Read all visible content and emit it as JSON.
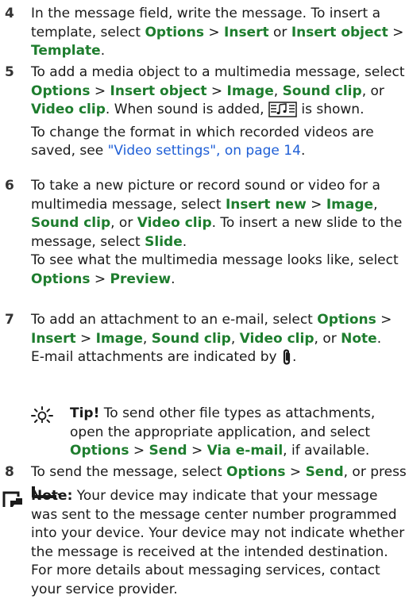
{
  "steps": [
    {
      "number": "4",
      "t1": "In the message field, write the message. To insert a template, select ",
      "options": "Options",
      "sep1": " > ",
      "insert": "Insert",
      "or1": " or ",
      "insert_object": "Insert object",
      "sep2": " > ",
      "template": "Template",
      "end": "."
    },
    {
      "number": "5",
      "t1": "To add a media object to a multimedia message, select ",
      "options": "Options",
      "sep1": " > ",
      "insert_object": "Insert object",
      "sep2": " > ",
      "image": "Image",
      "comma1": ", ",
      "sound_clip": "Sound clip",
      "or1": ", or ",
      "video_clip": "Video clip",
      "t2": ". When sound is added, ",
      "t3": " is shown.",
      "t4": "To change the format in which recorded videos are saved, see ",
      "link": "\"Video settings\", on page 14",
      "end": "."
    },
    {
      "number": "6",
      "t1": "To take a new picture or record sound or video for a multimedia message, select ",
      "insert_new": "Insert new",
      "sep1": " > ",
      "image": "Image",
      "comma1": ", ",
      "sound_clip": "Sound clip",
      "or1": ", or ",
      "video_clip": "Video clip",
      "t2": ". To insert a new slide to the message, select ",
      "slide": "Slide",
      "end1": ".",
      "t3": "To see what the multimedia message looks like, select ",
      "options": "Options",
      "sep2": " > ",
      "preview": "Preview",
      "end2": "."
    },
    {
      "number": "7",
      "t1": "To add an attachment to an e-mail, select ",
      "options": "Options",
      "sep1": " > ",
      "insert": "Insert",
      "sep2": " > ",
      "image": "Image",
      "comma1": ", ",
      "sound_clip": "Sound clip",
      "comma2": ", ",
      "video_clip": "Video clip",
      "or1": ", or ",
      "note": "Note",
      "end1": ".",
      "t2": "E-mail attachments are indicated by ",
      "end2": "."
    },
    {
      "number": "8",
      "t1": "To send the message, select ",
      "options": "Options",
      "sep1": " > ",
      "send": "Send",
      "t2": ", or press ",
      "end": "."
    }
  ],
  "tip": {
    "label": "Tip!",
    "t1": " To send other file types as attachments, open the appropriate application, and select ",
    "options": "Options",
    "sep1": " > ",
    "send": "Send",
    "sep2": " > ",
    "via_email": "Via e-mail",
    "t2": ", if available."
  },
  "note": {
    "label": "Note:",
    "text": " Your device may indicate that your message was sent to the message center number programmed into your device. Your device may not indicate whether the message is received at the intended destination. For more details about messaging services, contact your service provider."
  },
  "icons": {
    "sound_added": "sound-clip-icon",
    "attachment": "paperclip-icon",
    "send_key": "call-key-icon",
    "tip": "lightbulb-icon",
    "note": "note-hand-icon"
  },
  "colors": {
    "command": "#1e7d2e",
    "link": "#1f5fd6",
    "text": "#1a1a1a"
  }
}
